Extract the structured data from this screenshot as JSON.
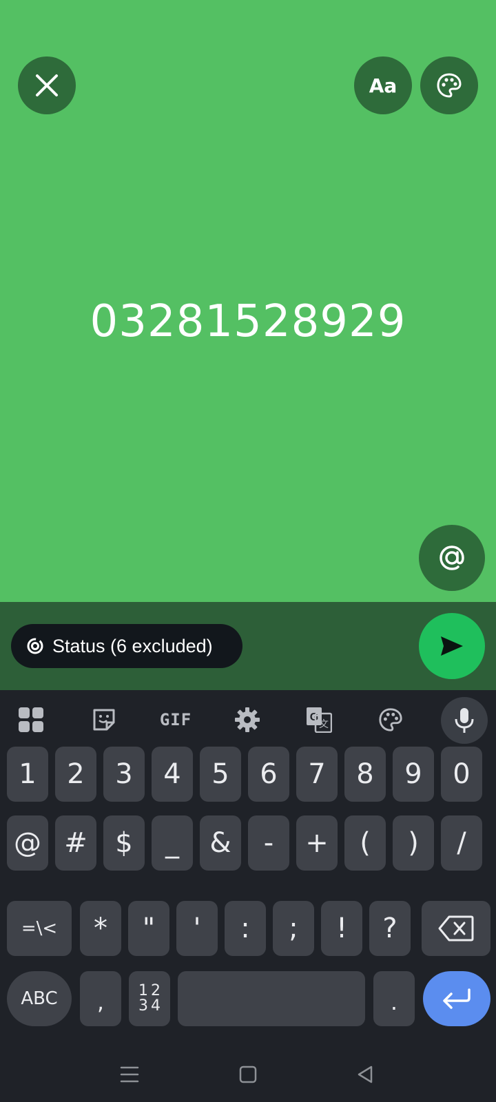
{
  "status": {
    "text": "03281528929",
    "font_button_label": "Aa",
    "background_color": "#54c063"
  },
  "audience": {
    "label": "Status (6 excluded)"
  },
  "keyboard": {
    "toolbar": [
      "apps-icon",
      "sticker-icon",
      "GIF",
      "settings-icon",
      "translate-icon",
      "theme-icon",
      "mic-icon"
    ],
    "gif_label": "GIF",
    "row1": [
      "1",
      "2",
      "3",
      "4",
      "5",
      "6",
      "7",
      "8",
      "9",
      "0"
    ],
    "row2": [
      "@",
      "#",
      "$",
      "_",
      "&",
      "-",
      "+",
      "(",
      ")",
      "/"
    ],
    "row3": [
      "=\\<",
      "*",
      "\"",
      "'",
      ":",
      ";",
      "!",
      "?"
    ],
    "abc_label": "ABC",
    "comma_label": ",",
    "numpad_label": [
      "1",
      "2",
      "3",
      "4"
    ],
    "period_label": ".",
    "enter_color": "#5b8def"
  }
}
